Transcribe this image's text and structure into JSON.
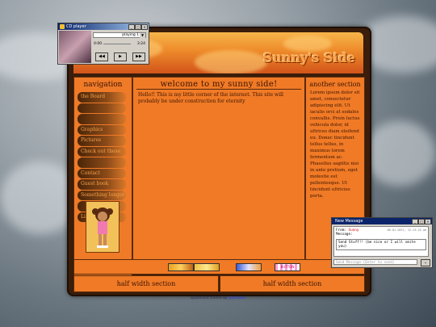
{
  "banner": {
    "title": "Sunny's Side"
  },
  "nav": {
    "heading": "navigation",
    "items": [
      "the Board",
      "",
      "",
      "Graphics",
      "Pictures",
      "Check out these",
      "",
      "Contact",
      "Guest book",
      "Something longer",
      "",
      "Link"
    ]
  },
  "main": {
    "heading": "welcome to my sunny side!",
    "text": "Hello!! This is my little corner of the internet. This site will probably be under construction for eternity"
  },
  "side": {
    "heading": "another section",
    "text": "Lorem ipsum dolor sit amet, consectetur adipiscing elit. Ut iaculis orci at sodales convallis. Proin luctus vehicula dolor, id ultrices diam eleifend eu. Donec tincidunt tellus tellus, in maximus lorem fermentum ac. Phasellus sagittis nisi in ante pretium, eget molestie est pellentesque. Ut tincidunt ultricies porta."
  },
  "strip": {
    "buttons": [
      "",
      "",
      "",
      "BUTTON"
    ]
  },
  "half_left": {
    "heading": "half width section"
  },
  "half_right": {
    "heading": "half width section"
  },
  "footer": {
    "text": "spacehost theme by",
    "link": "yibu.moo"
  },
  "cd_player": {
    "title": "CD player",
    "track": "playing 1",
    "time_start": "0:00",
    "time_end": "3:24",
    "prev": "◀◀",
    "play": "▶",
    "next": "▶▶"
  },
  "message": {
    "title": "New Message",
    "from_label": "From:",
    "from_name": "Sunny",
    "timestamp": "08.01.2021, 12:13:25 am",
    "message_label": "Message:",
    "body": "Send Stuff!! (be nice or I will smite you)",
    "input_placeholder": "Send Message (Enter to send)",
    "send_label": "→"
  }
}
